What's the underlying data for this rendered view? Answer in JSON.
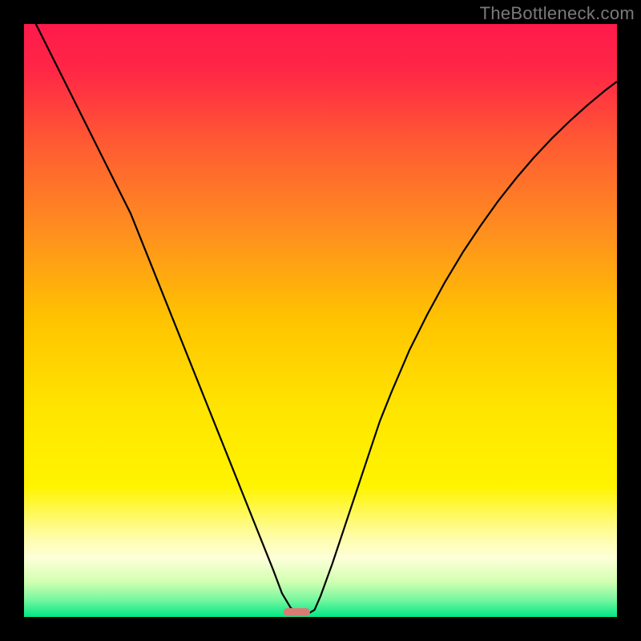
{
  "watermark": "TheBottleneck.com",
  "chart_data": {
    "type": "line",
    "title": "",
    "xlabel": "",
    "ylabel": "",
    "xlim": [
      0,
      100
    ],
    "ylim": [
      0,
      100
    ],
    "grid": false,
    "legend": false,
    "background_gradient": [
      {
        "pos": 0.0,
        "color": "#ff1a4b"
      },
      {
        "pos": 0.08,
        "color": "#ff2746"
      },
      {
        "pos": 0.2,
        "color": "#ff5a33"
      },
      {
        "pos": 0.35,
        "color": "#ff8f1f"
      },
      {
        "pos": 0.5,
        "color": "#ffc400"
      },
      {
        "pos": 0.65,
        "color": "#ffe500"
      },
      {
        "pos": 0.78,
        "color": "#fff400"
      },
      {
        "pos": 0.86,
        "color": "#fffca0"
      },
      {
        "pos": 0.9,
        "color": "#fdffd9"
      },
      {
        "pos": 0.94,
        "color": "#d3ffb2"
      },
      {
        "pos": 0.97,
        "color": "#7bf7a0"
      },
      {
        "pos": 1.0,
        "color": "#00e884"
      }
    ],
    "series": [
      {
        "name": "curve",
        "color": "#000000",
        "width": 2.2,
        "x": [
          0,
          2,
          4,
          6,
          8,
          10,
          12,
          14,
          16,
          18,
          20,
          22,
          24,
          26,
          28,
          30,
          32,
          34,
          36,
          38,
          40,
          42,
          43.5,
          45,
          46,
          47,
          48,
          49,
          50,
          52,
          54,
          56,
          58,
          60,
          62,
          65,
          68,
          71,
          74,
          77,
          80,
          83,
          86,
          89,
          92,
          95,
          98,
          100
        ],
        "y": [
          103,
          100,
          96,
          92,
          88,
          84,
          80,
          76,
          72,
          68,
          63,
          58,
          53,
          48,
          43,
          38,
          33,
          28,
          23,
          18,
          13,
          8,
          4,
          1.5,
          0.8,
          0.5,
          0.6,
          1.2,
          3.5,
          9,
          15,
          21,
          27,
          33,
          38,
          45,
          51,
          56.5,
          61.5,
          66,
          70.2,
          74,
          77.5,
          80.7,
          83.6,
          86.3,
          88.8,
          90.3
        ]
      }
    ],
    "marker": {
      "x_center": 46,
      "width": 4.5,
      "y": 0,
      "color": "#d97b74",
      "radius": 5
    }
  }
}
